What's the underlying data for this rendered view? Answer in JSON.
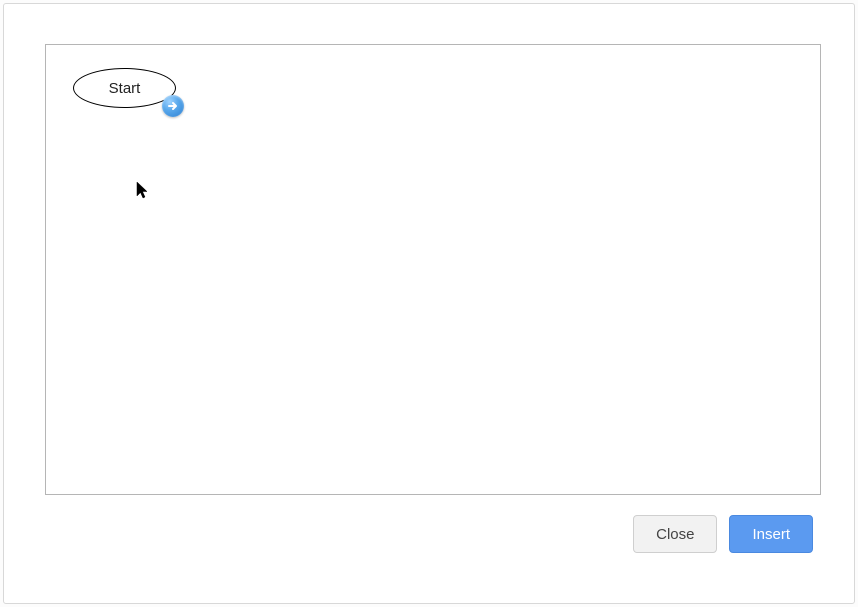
{
  "canvas": {
    "start_node": {
      "label": "Start"
    },
    "connector_handle": {
      "icon": "arrow-right"
    }
  },
  "buttons": {
    "close_label": "Close",
    "insert_label": "Insert"
  }
}
